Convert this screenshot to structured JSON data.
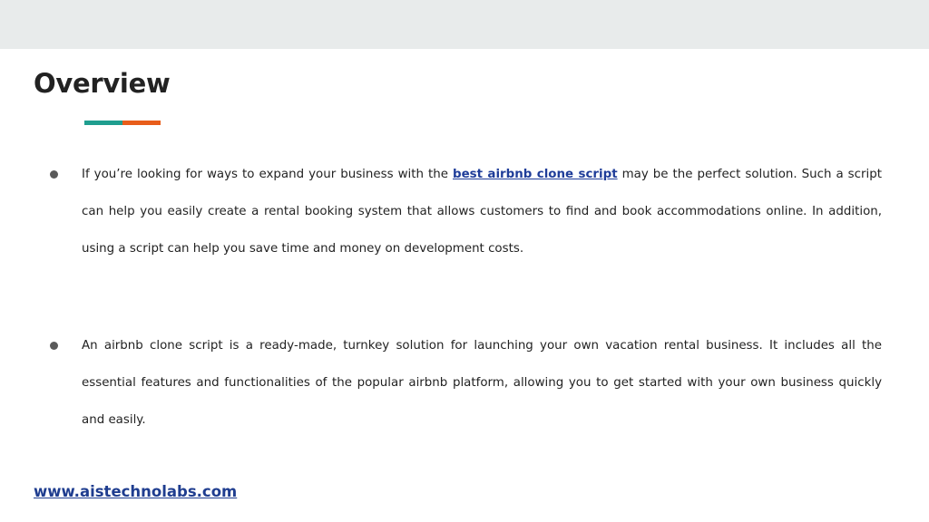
{
  "slide": {
    "title": "Overview",
    "accent_colors": {
      "teal": "#1f9e8f",
      "orange": "#e85d1a"
    },
    "bullets": [
      {
        "before": "If you’re looking for ways to expand your business with the ",
        "link_text": "best airbnb clone script",
        "after": " may be the perfect solution. Such a script can help you easily create a rental booking system that allows customers to find and book accommodations online. In addition, using a script can help you save time and money on development costs."
      },
      {
        "text": "An airbnb clone script is a ready-made, turnkey solution for launching your own vacation rental business. It includes all the essential features and functionalities of the popular airbnb platform, allowing you to get started with your own business quickly and easily."
      }
    ],
    "footer_link": "www.aistechnolabs.com"
  }
}
